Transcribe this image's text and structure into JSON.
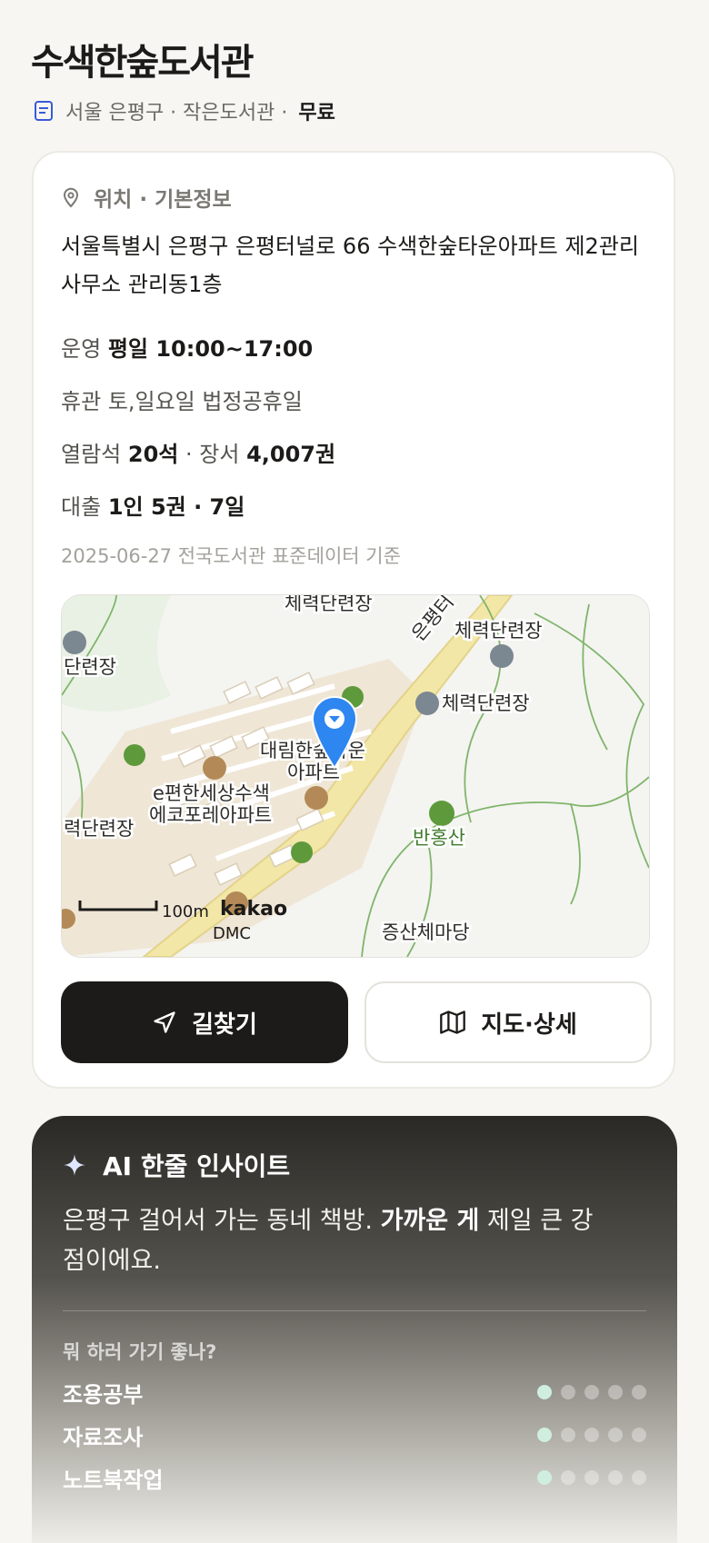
{
  "header": {
    "title": "수색한숲도서관",
    "meta": "서울 은평구 · 작은도서관 ·",
    "fee": "무료"
  },
  "info": {
    "section_title": "위치 · 기본정보",
    "address": "서울특별시 은평구 은평터널로 66 수색한숲타운아파트 제2관리사무소 관리동1층",
    "hours_label": "운영",
    "hours_value": "평일 10:00~17:00",
    "closed_label": "휴관",
    "closed_value": "토,일요일 법정공휴일",
    "seats_label": "열람석",
    "seats_value": "20석",
    "books_sep": "· 장서",
    "books_value": "4,007권",
    "loan_label": "대출",
    "loan_value": "1인 5권 · 7일",
    "data_note": "2025-06-27 전국도서관 표준데이터 기준"
  },
  "map": {
    "labels": {
      "gym_top": "체력단련장",
      "gym_right1": "체력단련장",
      "gym_right2": "체력단련장",
      "gym_left": "단련장",
      "gym_left2": "력단련장",
      "apt1_line1": "대림한숲타운",
      "apt1_line2": "아파트",
      "apt2_line1": "e편한세상수색",
      "apt2_line2": "에코포레아파트",
      "mountain": "반홍산",
      "scale": "100m",
      "logo": "kakao",
      "dmc": "DMC",
      "bottom_partial": "증산체마당",
      "road": "은평터"
    },
    "colors": {
      "marker": "#2e86f0",
      "road": "#f2e7a6",
      "residential": "#efe6d6",
      "forest": "#e9f1e4",
      "trail": "#7fb56a"
    }
  },
  "actions": {
    "directions_label": "길찾기",
    "map_label": "지도·상세"
  },
  "ai": {
    "title": "AI 한줄 인사이트",
    "text_1": "은평구 걸어서 가는 동네 책방.",
    "text_bold": "가까운 게",
    "text_2": "제일 큰 강점이에요.",
    "question": "뭐 하러 가기 좋나?",
    "ratings": [
      {
        "label": "조용공부",
        "score": 1,
        "max": 5
      },
      {
        "label": "자료조사",
        "score": 1,
        "max": 5
      },
      {
        "label": "노트북작업",
        "score": 1,
        "max": 5
      }
    ]
  }
}
